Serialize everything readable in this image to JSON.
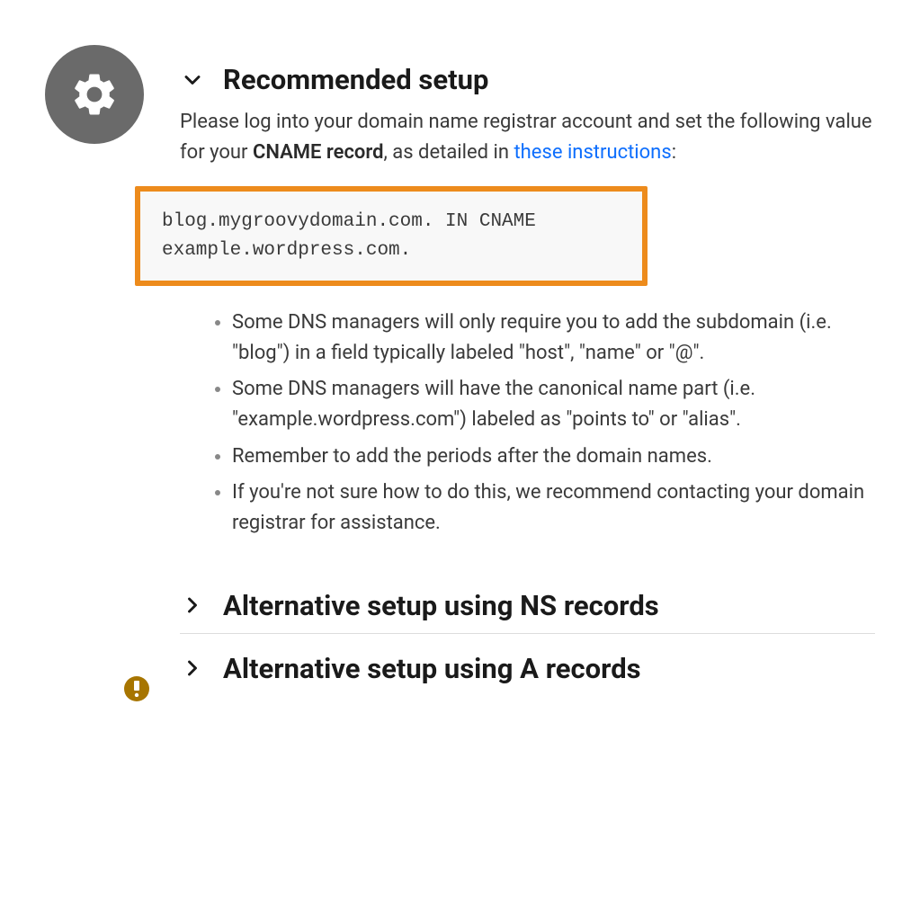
{
  "icon": {
    "main": "gear-icon",
    "badge": "alert-icon"
  },
  "sections": {
    "recommended": {
      "title": "Recommended setup",
      "expanded": true,
      "intro": {
        "part1": "Please log into your domain name registrar account and set the following value for your ",
        "bold": "CNAME record",
        "part2": ", as detailed in ",
        "link_text": "these instructions",
        "part3": ":"
      },
      "code_line1": "blog.mygroovydomain.com. IN CNAME",
      "code_line2": "example.wordpress.com.",
      "bullets": [
        "Some DNS managers will only require you to add the subdomain (i.e. \"blog\") in a field typically labeled \"host\", \"name\" or \"@\".",
        "Some DNS managers will have the canonical name part (i.e. \"example.wordpress.com\") labeled as \"points to\" or \"alias\".",
        "Remember to add the periods after the domain names.",
        "If you're not sure how to do this, we recommend contacting your domain registrar for assistance."
      ]
    },
    "ns": {
      "title": "Alternative setup using NS records",
      "expanded": false
    },
    "a": {
      "title": "Alternative setup using A records",
      "expanded": false
    }
  },
  "colors": {
    "highlight_border": "#ed8b1c",
    "link": "#0d6efd",
    "icon_bg": "#6a6a6a",
    "badge_bg": "#a77500"
  }
}
